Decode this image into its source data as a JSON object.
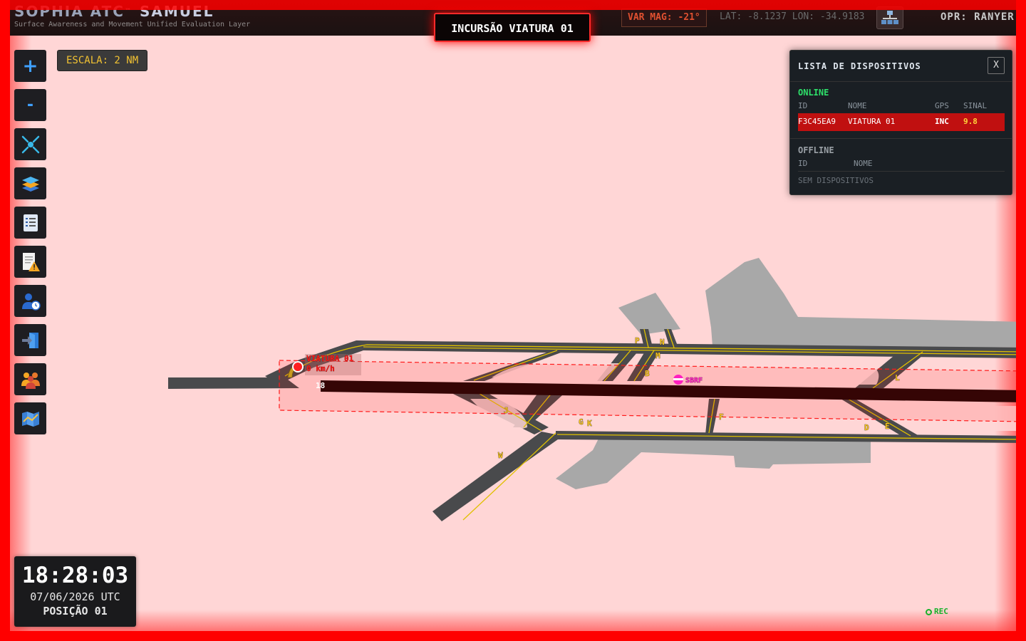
{
  "header": {
    "brand_name": "SOPHIA ATC",
    "brand_tm": "™",
    "brand_name2": "SAMUEL",
    "brand_subtitle": "Surface Awareness and Movement Unified Evaluation Layer",
    "alert_text": "INCURSÃO VIATURA 01",
    "var_mag": "VAR MAG: -21°",
    "coordinates": "LAT: -8.1237 LON: -34.9183",
    "network_icon": "network-icon",
    "operator": "OPR: RANYER"
  },
  "map": {
    "scale_label": "ESCALA: 2 NM",
    "runway_label": "18",
    "vehicle_name": "VIATURA 01",
    "vehicle_speed": "0 km/h",
    "airport_label": "SBRF",
    "taxiways": [
      "P",
      "N",
      "M",
      "B",
      "L",
      "J",
      "G",
      "K",
      "F",
      "D",
      "E",
      "W"
    ]
  },
  "toolbar": {
    "zoom_in": "+",
    "zoom_out": "-",
    "icons": [
      "recenter-icon",
      "layers-icon",
      "checklist-icon",
      "report-warning-icon",
      "user-clock-icon",
      "logout-icon",
      "team-icon",
      "map-icon"
    ]
  },
  "device_panel": {
    "title": "LISTA DE DISPOSITIVOS",
    "close_label": "X",
    "online_label": "ONLINE",
    "columns": {
      "id": "ID",
      "name": "NOME",
      "gps": "GPS",
      "signal": "SINAL"
    },
    "online_devices": [
      {
        "id": "F3C45EA9",
        "name": "VIATURA 01",
        "gps": "INC",
        "signal": "9.8"
      }
    ],
    "offline_label": "OFFLINE",
    "offline_columns": {
      "id": "ID",
      "name": "NOME"
    },
    "offline_empty": "SEM DISPOSITIVOS"
  },
  "clock": {
    "time": "18:28:03",
    "date": "07/06/2026 UTC",
    "position": "POSIÇÃO 01"
  },
  "status": {
    "rec_label": "REC"
  },
  "colors": {
    "alert_red": "#ff0000",
    "taxiway_yellow": "#f6c31c",
    "online_green": "#2ee06a",
    "map_bg": "#ffd4d4"
  }
}
